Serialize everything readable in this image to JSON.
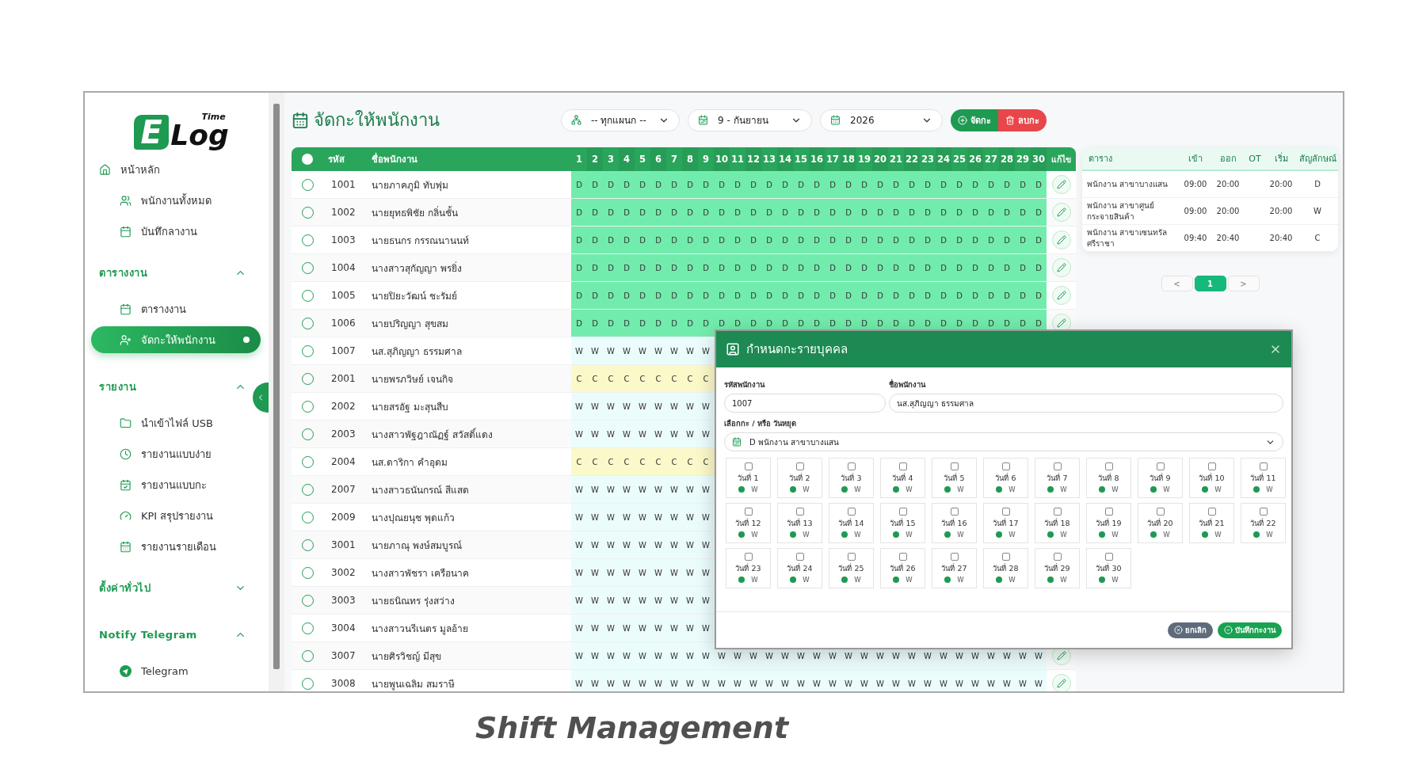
{
  "sidebar": {
    "logo": {
      "mark": "E",
      "name": "Log",
      "tag": "Time"
    },
    "home": {
      "label": "หน้าหลัก",
      "selected": false,
      "children": [
        {
          "label": "พนักงานทั้งหมด",
          "selected": false
        },
        {
          "label": "บันทึกลางาน",
          "selected": false
        }
      ]
    },
    "sections": [
      {
        "title": "ตารางงาน",
        "expanded": true,
        "items": [
          {
            "label": "ตารางงาน",
            "selected": false
          },
          {
            "label": "จัดกะให้พนักงาน",
            "selected": true
          }
        ]
      },
      {
        "title": "รายงาน",
        "expanded": true,
        "items": [
          {
            "label": "นำเข้าไฟล์ USB",
            "selected": false
          },
          {
            "label": "รายงานแบบง่าย",
            "selected": false
          },
          {
            "label": "รายงานแบบกะ",
            "selected": false
          },
          {
            "label": "KPI สรุปรายงาน",
            "selected": false
          },
          {
            "label": "รายงานรายเดือน",
            "selected": false
          }
        ]
      },
      {
        "title": "ตั้งค่าทั่วไป",
        "expanded": false
      },
      {
        "title": "Notify Telegram",
        "expanded": true,
        "items": [
          {
            "label": "Telegram",
            "selected": false
          }
        ]
      }
    ]
  },
  "page_title": "จัดกะให้พนักงาน",
  "filters": [
    {
      "value": "-- ทุกแผนก --"
    },
    {
      "value": "9 - กันยายน"
    },
    {
      "value": "2026"
    }
  ],
  "actions": [
    {
      "kind": "add",
      "label": "จัดกะ"
    },
    {
      "kind": "delete",
      "label": "ลบกะ"
    }
  ],
  "table": {
    "select_all": {
      "selected": false
    },
    "columns": {
      "code": "รหัส",
      "name": "ชื่อพนักงาน",
      "edit": "แก้ไข"
    },
    "day_columns": [
      "1",
      "2",
      "3",
      "4",
      "5",
      "6",
      "7",
      "8",
      "9",
      "10",
      "11",
      "12",
      "13",
      "14",
      "15",
      "16",
      "17",
      "18",
      "19",
      "20",
      "21",
      "22",
      "23",
      "24",
      "25",
      "26",
      "27",
      "28",
      "29",
      "30"
    ],
    "rows": [
      {
        "code": "1001",
        "name": "นายภาคภูมิ ทับพุ่ม",
        "selected": false,
        "color": "#72ecac",
        "shifts": [
          "D",
          "D",
          "D",
          "D",
          "D",
          "D",
          "D",
          "D",
          "D",
          "D",
          "D",
          "D",
          "D",
          "D",
          "D",
          "D",
          "D",
          "D",
          "D",
          "D",
          "D",
          "D",
          "D",
          "D",
          "D",
          "D",
          "D",
          "D",
          "D",
          "D"
        ]
      },
      {
        "code": "1002",
        "name": "นายยุทธพิชัย กลิ่นชั้น",
        "selected": false,
        "color": "#72ecac",
        "shifts": [
          "D",
          "D",
          "D",
          "D",
          "D",
          "D",
          "D",
          "D",
          "D",
          "D",
          "D",
          "D",
          "D",
          "D",
          "D",
          "D",
          "D",
          "D",
          "D",
          "D",
          "D",
          "D",
          "D",
          "D",
          "D",
          "D",
          "D",
          "D",
          "D",
          "D"
        ]
      },
      {
        "code": "1003",
        "name": "นายธนกร กรรณนานนท์",
        "selected": false,
        "color": "#72ecac",
        "shifts": [
          "D",
          "D",
          "D",
          "D",
          "D",
          "D",
          "D",
          "D",
          "D",
          "D",
          "D",
          "D",
          "D",
          "D",
          "D",
          "D",
          "D",
          "D",
          "D",
          "D",
          "D",
          "D",
          "D",
          "D",
          "D",
          "D",
          "D",
          "D",
          "D",
          "D"
        ]
      },
      {
        "code": "1004",
        "name": "นางสาวสุกัญญา พรยิ่ง",
        "selected": false,
        "color": "#72ecac",
        "shifts": [
          "D",
          "D",
          "D",
          "D",
          "D",
          "D",
          "D",
          "D",
          "D",
          "D",
          "D",
          "D",
          "D",
          "D",
          "D",
          "D",
          "D",
          "D",
          "D",
          "D",
          "D",
          "D",
          "D",
          "D",
          "D",
          "D",
          "D",
          "D",
          "D",
          "D"
        ]
      },
      {
        "code": "1005",
        "name": "นายปิยะวัฒน์ ชะรัมย์",
        "selected": false,
        "color": "#72ecac",
        "shifts": [
          "D",
          "D",
          "D",
          "D",
          "D",
          "D",
          "D",
          "D",
          "D",
          "D",
          "D",
          "D",
          "D",
          "D",
          "D",
          "D",
          "D",
          "D",
          "D",
          "D",
          "D",
          "D",
          "D",
          "D",
          "D",
          "D",
          "D",
          "D",
          "D",
          "D"
        ]
      },
      {
        "code": "1006",
        "name": "นายปริญญา สุขสม",
        "selected": false,
        "color": "#72ecac",
        "shifts": [
          "D",
          "D",
          "D",
          "D",
          "D",
          "D",
          "D",
          "D",
          "D",
          "D",
          "D",
          "D",
          "D",
          "D",
          "D",
          "D",
          "D",
          "D",
          "D",
          "D",
          "D",
          "D",
          "D",
          "D",
          "D",
          "D",
          "D",
          "D",
          "D",
          "D"
        ]
      },
      {
        "code": "1007",
        "name": "นส.สุภิญญา ธรรมศาล",
        "selected": false,
        "color": "#ebfcfc",
        "shifts": [
          "W",
          "W",
          "W",
          "W",
          "W",
          "W",
          "W",
          "W",
          "W"
        ]
      },
      {
        "code": "2001",
        "name": "นายพรภวิษย์ เจนกิจ",
        "selected": false,
        "color": "#fbf9c9",
        "shifts": [
          "C",
          "C",
          "C",
          "C",
          "C",
          "C",
          "C",
          "C",
          "C"
        ]
      },
      {
        "code": "2002",
        "name": "นายสรอัฐ มะสุนสืบ",
        "selected": false,
        "color": "#ebfcfc",
        "shifts": [
          "W",
          "W",
          "W",
          "W",
          "W",
          "W",
          "W",
          "W",
          "W"
        ]
      },
      {
        "code": "2003",
        "name": "นางสาวพัฐฎาณัฏฐ์ สวัสดิ์แดง",
        "selected": false,
        "color": "#ebfcfc",
        "shifts": [
          "W",
          "W",
          "W",
          "W",
          "W",
          "W",
          "W",
          "W",
          "W"
        ]
      },
      {
        "code": "2004",
        "name": "นส.ดาริกา คำอุดม",
        "selected": false,
        "color": "#fbf9c9",
        "shifts": [
          "C",
          "C",
          "C",
          "C",
          "C",
          "C",
          "C",
          "C",
          "C"
        ]
      },
      {
        "code": "2007",
        "name": "นางสาวธนันกรณ์ สีแสด",
        "selected": false,
        "color": "#ebfcfc",
        "shifts": [
          "W",
          "W",
          "W",
          "W",
          "W",
          "W",
          "W",
          "W",
          "W"
        ]
      },
      {
        "code": "2009",
        "name": "นางปุณยนุช พุดแก้ว",
        "selected": false,
        "color": "#ebfcfc",
        "shifts": [
          "W",
          "W",
          "W",
          "W",
          "W",
          "W",
          "W",
          "W",
          "W"
        ]
      },
      {
        "code": "3001",
        "name": "นายภาณุ พงษ์สมบูรณ์",
        "selected": false,
        "color": "#ebfcfc",
        "shifts": [
          "W",
          "W",
          "W",
          "W",
          "W",
          "W",
          "W",
          "W",
          "W"
        ]
      },
      {
        "code": "3002",
        "name": "นางสาวพัชรา เครือนาค",
        "selected": false,
        "color": "#ebfcfc",
        "shifts": [
          "W",
          "W",
          "W",
          "W",
          "W",
          "W",
          "W",
          "W",
          "W"
        ]
      },
      {
        "code": "3003",
        "name": "นายธนิณทร รุ่งสว่าง",
        "selected": false,
        "color": "#ebfcfc",
        "shifts": [
          "W",
          "W",
          "W",
          "W",
          "W",
          "W",
          "W",
          "W",
          "W"
        ]
      },
      {
        "code": "3004",
        "name": "นางสาวนรีเนตร มูลอ้าย",
        "selected": false,
        "color": "#ebfcfc",
        "shifts": [
          "W",
          "W",
          "W",
          "W",
          "W",
          "W",
          "W",
          "W",
          "W"
        ]
      },
      {
        "code": "3007",
        "name": "นายศิรวิชญ์ มีสุข",
        "selected": false,
        "color": "#ebfcfc",
        "shifts": [
          "W",
          "W",
          "W",
          "W",
          "W",
          "W",
          "W",
          "W",
          "W",
          "W",
          "W",
          "W",
          "W",
          "W",
          "W",
          "W",
          "W",
          "W",
          "W",
          "W",
          "W",
          "W",
          "W",
          "W",
          "W",
          "W",
          "W",
          "W",
          "W",
          "W"
        ]
      },
      {
        "code": "3008",
        "name": "นายพูนเฉลิม สมราษี",
        "selected": false,
        "color": "#ebfcfc",
        "shifts": [
          "W",
          "W",
          "W",
          "W",
          "W",
          "W",
          "W",
          "W",
          "W",
          "W",
          "W",
          "W",
          "W",
          "W",
          "W",
          "W",
          "W",
          "W",
          "W",
          "W",
          "W",
          "W",
          "W",
          "W",
          "W",
          "W",
          "W",
          "W",
          "W",
          "W"
        ]
      }
    ]
  },
  "shift_table": {
    "columns": [
      "ตาราง",
      "เข้า",
      "ออก",
      "OT",
      "เริ่ม",
      "สัญลักษณ์"
    ],
    "rows": [
      {
        "name": "พนักงาน สาขาบางแสน",
        "in": "09:00",
        "out": "20:00",
        "start": "20:00",
        "symbol": "D"
      },
      {
        "name": "พนักงาน สาขาศูนย์กระจายสินค้า",
        "in": "09:00",
        "out": "20:00",
        "start": "20:00",
        "symbol": "W"
      },
      {
        "name": "พนักงาน สาขาเซนทรัลศรีราชา",
        "in": "09:40",
        "out": "20:40",
        "start": "20:40",
        "symbol": "C"
      }
    ]
  },
  "pagination": {
    "prev": "<",
    "next": ">",
    "pages": [
      {
        "label": "1",
        "selected": true
      }
    ]
  },
  "modal": {
    "title": "กำหนดกะรายบุคคล",
    "fields": [
      {
        "label": "รหัสพนักงาน",
        "value": "1007"
      },
      {
        "label": "ชื่อพนักงาน",
        "value": "นส.สุภิญญา ธรรมศาล"
      }
    ],
    "shift_select": {
      "label": "เลือกกะ / หรือ วันหยุด",
      "value": "D พนักงาน สาขาบางแสน"
    },
    "days": [
      {
        "label": "วันที่ 1",
        "code": "W",
        "checked": false
      },
      {
        "label": "วันที่ 2",
        "code": "W",
        "checked": false
      },
      {
        "label": "วันที่ 3",
        "code": "W",
        "checked": false
      },
      {
        "label": "วันที่ 4",
        "code": "W",
        "checked": false
      },
      {
        "label": "วันที่ 5",
        "code": "W",
        "checked": false
      },
      {
        "label": "วันที่ 6",
        "code": "W",
        "checked": false
      },
      {
        "label": "วันที่ 7",
        "code": "W",
        "checked": false
      },
      {
        "label": "วันที่ 8",
        "code": "W",
        "checked": false
      },
      {
        "label": "วันที่ 9",
        "code": "W",
        "checked": false
      },
      {
        "label": "วันที่ 10",
        "code": "W",
        "checked": false
      },
      {
        "label": "วันที่ 11",
        "code": "W",
        "checked": false
      },
      {
        "label": "วันที่ 12",
        "code": "W",
        "checked": false
      },
      {
        "label": "วันที่ 13",
        "code": "W",
        "checked": false
      },
      {
        "label": "วันที่ 14",
        "code": "W",
        "checked": false
      },
      {
        "label": "วันที่ 15",
        "code": "W",
        "checked": false
      },
      {
        "label": "วันที่ 16",
        "code": "W",
        "checked": false
      },
      {
        "label": "วันที่ 17",
        "code": "W",
        "checked": false
      },
      {
        "label": "วันที่ 18",
        "code": "W",
        "checked": false
      },
      {
        "label": "วันที่ 19",
        "code": "W",
        "checked": false
      },
      {
        "label": "วันที่ 20",
        "code": "W",
        "checked": false
      },
      {
        "label": "วันที่ 21",
        "code": "W",
        "checked": false
      },
      {
        "label": "วันที่ 22",
        "code": "W",
        "checked": false
      },
      {
        "label": "วันที่ 23",
        "code": "W",
        "checked": false
      },
      {
        "label": "วันที่ 24",
        "code": "W",
        "checked": false
      },
      {
        "label": "วันที่ 25",
        "code": "W",
        "checked": false
      },
      {
        "label": "วันที่ 26",
        "code": "W",
        "checked": false
      },
      {
        "label": "วันที่ 27",
        "code": "W",
        "checked": false
      },
      {
        "label": "วันที่ 28",
        "code": "W",
        "checked": false
      },
      {
        "label": "วันที่ 29",
        "code": "W",
        "checked": false
      },
      {
        "label": "วันที่ 30",
        "code": "W",
        "checked": false
      }
    ],
    "buttons": [
      {
        "kind": "cancel",
        "label": "ยกเลิก"
      },
      {
        "kind": "save",
        "label": "บันทึกกะงาน"
      }
    ]
  },
  "caption": "Shift Management"
}
